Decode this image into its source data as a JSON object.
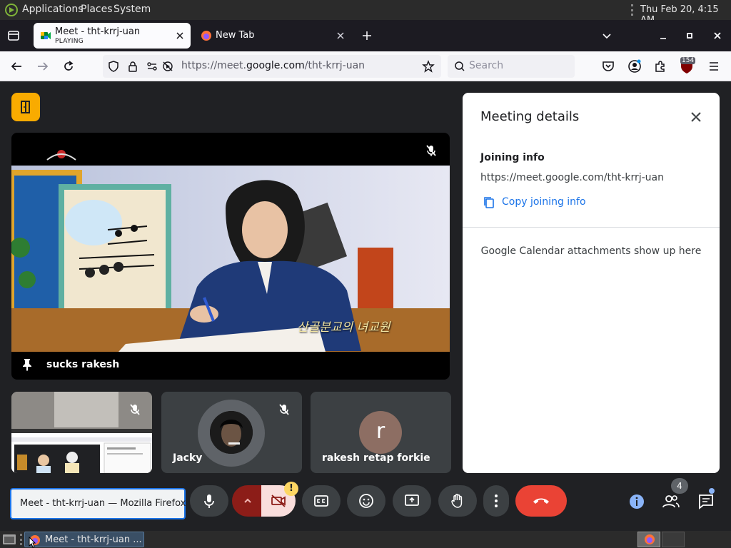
{
  "top_panel": {
    "menus": [
      "Applications",
      "Places",
      "System"
    ],
    "clock": "Thu Feb 20,  4:15 AM"
  },
  "browser": {
    "tabs": [
      {
        "title": "Meet - tht-krrj-uan",
        "subtitle": "PLAYING",
        "active": true
      },
      {
        "title": "New Tab",
        "active": false
      }
    ],
    "url_prefix": "https://meet.",
    "url_domain": "google.com",
    "url_path": "/tht-krrj-uan",
    "search_placeholder": "Search",
    "ublock_badge": "154"
  },
  "meet": {
    "main_tile_name": "sucks rakesh",
    "main_tile_caption": "산골분교의 녀교원",
    "participants": [
      {
        "name": "Jacky"
      },
      {
        "name": "rakesh retap forkie",
        "initial": "r"
      }
    ],
    "people_count": "4",
    "tooltip": "Meet - tht-krrj-uan — Mozilla Firefox"
  },
  "details": {
    "title": "Meeting details",
    "joining_heading": "Joining info",
    "joining_url": "https://meet.google.com/tht-krrj-uan",
    "copy_label": "Copy joining info",
    "attachments_text": "Google Calendar attachments show up here"
  },
  "taskbar": {
    "window_label": "Meet - tht-krrj-uan ..."
  },
  "colors": {
    "meet_bg": "#202124",
    "tile_bg": "#3c4043",
    "end_call": "#ea4335",
    "accent_blue": "#1a73e8",
    "warn_yellow": "#fdd663"
  }
}
